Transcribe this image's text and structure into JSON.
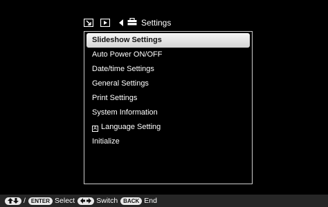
{
  "tabs": {
    "active_title": "Settings",
    "icons": [
      "edit-tab-icon",
      "play-tab-icon",
      "toolbox-icon"
    ]
  },
  "menu": {
    "items": [
      {
        "label": "Slideshow Settings",
        "selected": true
      },
      {
        "label": "Auto Power ON/OFF",
        "selected": false
      },
      {
        "label": "Date/time Settings",
        "selected": false
      },
      {
        "label": "General Settings",
        "selected": false
      },
      {
        "label": "Print Settings",
        "selected": false
      },
      {
        "label": "System Information",
        "selected": false
      },
      {
        "label": "Language Setting",
        "selected": false,
        "icon": "A"
      },
      {
        "label": "Initialize",
        "selected": false
      }
    ]
  },
  "guide": {
    "slash": "/",
    "enter_key": "ENTER",
    "select_label": "Select",
    "switch_label": "Switch",
    "back_key": "BACK",
    "end_label": "End"
  }
}
